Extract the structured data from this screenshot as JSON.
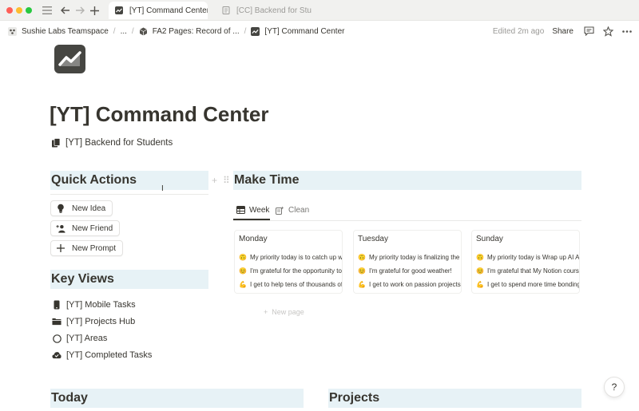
{
  "window": {
    "tabs": [
      {
        "label": "[YT] Command Center",
        "active": true
      },
      {
        "label": "[CC] Backend for Stud",
        "active": false
      }
    ]
  },
  "breadcrumb": {
    "items": [
      "Sushie Labs Teamspace",
      "...",
      "FA2 Pages: Record of ...",
      "[YT] Command Center"
    ]
  },
  "topbar": {
    "edited": "Edited 2m ago",
    "share": "Share"
  },
  "page": {
    "title": "[YT] Command Center",
    "backlink": "[YT] Backend for Students"
  },
  "quick_actions": {
    "heading": "Quick Actions",
    "buttons": [
      {
        "label": "New Idea",
        "icon": "lightbulb-icon"
      },
      {
        "label": "New Friend",
        "icon": "add-person-icon"
      },
      {
        "label": "New Prompt",
        "icon": "plus-icon"
      }
    ]
  },
  "key_views": {
    "heading": "Key Views",
    "items": [
      {
        "label": "[YT] Mobile Tasks",
        "icon": "phone-icon"
      },
      {
        "label": "[YT] Projects Hub",
        "icon": "folder-icon"
      },
      {
        "label": "[YT] Areas",
        "icon": "circle-icon"
      },
      {
        "label": "[YT] Completed Tasks",
        "icon": "cloud-check-icon"
      }
    ]
  },
  "make_time": {
    "heading": "Make Time",
    "tabs": [
      {
        "label": "Week",
        "active": true
      },
      {
        "label": "Clean",
        "active": false
      }
    ],
    "columns": [
      {
        "title": "Monday",
        "lines": [
          {
            "emoji": "🙃",
            "text": "My priority today is to catch up w"
          },
          {
            "emoji": "😊",
            "text": "I'm grateful for the opportunity to"
          },
          {
            "emoji": "💪",
            "text": "I get to help tens of thousands of"
          }
        ]
      },
      {
        "title": "Tuesday",
        "lines": [
          {
            "emoji": "🙃",
            "text": "My priority today is finalizing the"
          },
          {
            "emoji": "😊",
            "text": "I'm grateful for good weather!"
          },
          {
            "emoji": "💪",
            "text": "I get to work on passion projects"
          }
        ]
      },
      {
        "title": "Sunday",
        "lines": [
          {
            "emoji": "🙃",
            "text": "My priority today is Wrap up AI A"
          },
          {
            "emoji": "😊",
            "text": "I'm grateful that My Notion cours"
          },
          {
            "emoji": "💪",
            "text": "I get to spend more time bonding"
          }
        ]
      }
    ],
    "new_page": "New page"
  },
  "bottom_sections": {
    "today": "Today",
    "projects": "Projects"
  },
  "help": "?"
}
